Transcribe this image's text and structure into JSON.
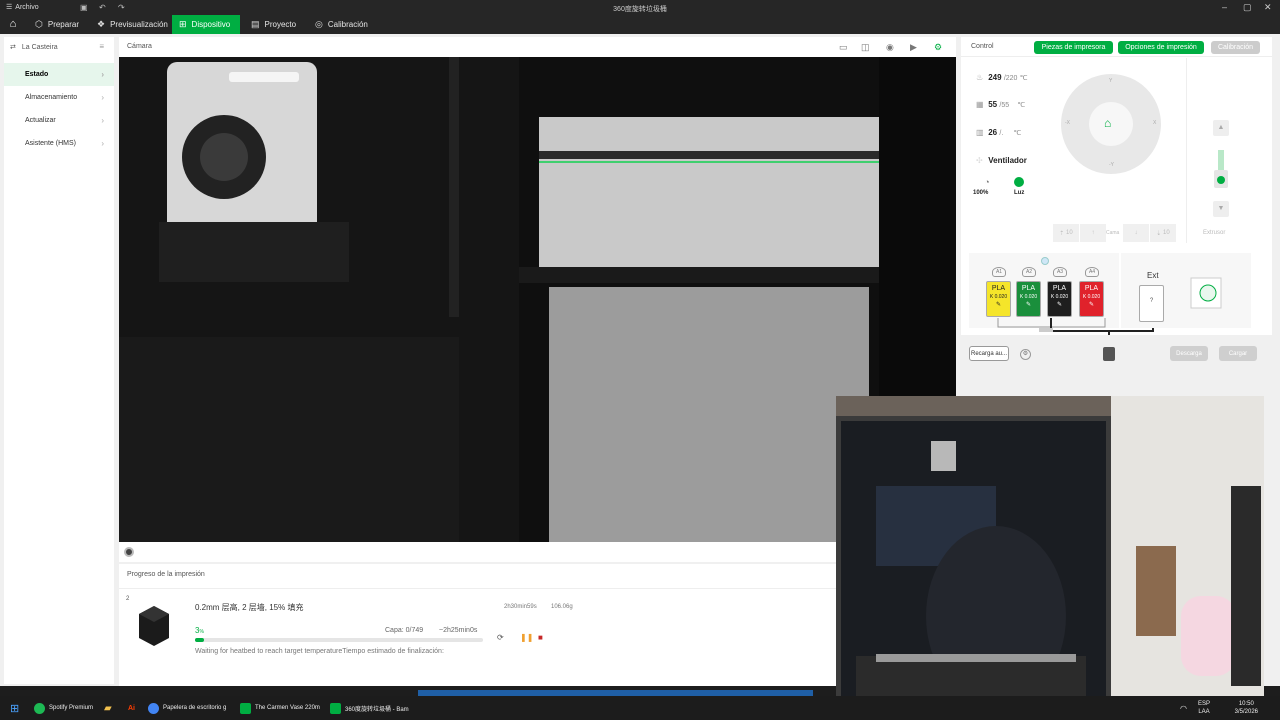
{
  "window": {
    "title": "360度旋转垃圾桶",
    "menu_label": "Archivo"
  },
  "nav": {
    "tabs": [
      {
        "label": "Preparar"
      },
      {
        "label": "Previsualización"
      },
      {
        "label": "Dispositivo"
      },
      {
        "label": "Proyecto"
      },
      {
        "label": "Calibración"
      }
    ]
  },
  "sidebar": {
    "printer_name": "La Casteira",
    "items": [
      {
        "label": "Estado"
      },
      {
        "label": "Almacenamiento"
      },
      {
        "label": "Actualizar"
      },
      {
        "label": "Asistente (HMS)"
      }
    ]
  },
  "camera": {
    "label": "Cámara"
  },
  "progress": {
    "title": "Progreso de la impresión",
    "count": "2",
    "job_name": "0.2mm 层高, 2 层墙, 15% 填充",
    "time": "2h30min59s",
    "weight": "106.06g",
    "percent": "3",
    "percent_unit": "%",
    "layer": "Capa: 0/749",
    "remaining": "~2h25min0s",
    "status": "Waiting for heatbed to reach target temperature",
    "eta_label": "Tiempo estimado de finalización:",
    "fraction": 0.03
  },
  "control": {
    "label": "Control",
    "btn_parts": "Piezas de impresora",
    "btn_options": "Opciones de impresión",
    "btn_calibration": "Calibración",
    "nozzle_temp": "249",
    "nozzle_target": "/220",
    "bed_temp": "55",
    "bed_target": "/55",
    "chamber_temp": "26",
    "chamber_target": "/.",
    "unit": "℃",
    "fan_label": "Ventilador",
    "fan_value": "100%",
    "light_label": "Luz",
    "extruder_label": "Extrusor",
    "step_up_10": "10",
    "step_cama": "Cama",
    "step_down_10": "10"
  },
  "ams": {
    "slots": [
      {
        "id": "A1",
        "type": "PLA",
        "k": "K 0.020",
        "color": "#f5e52a",
        "text": "#222"
      },
      {
        "id": "A2",
        "type": "PLA",
        "k": "K 0.020",
        "color": "#1a8f3c",
        "text": "#fff"
      },
      {
        "id": "A3",
        "type": "PLA",
        "k": "K 0.020",
        "color": "#1e1e1e",
        "text": "#fff"
      },
      {
        "id": "A4",
        "type": "PLA",
        "k": "K 0.020",
        "color": "#e0222b",
        "text": "#fff"
      }
    ],
    "ext_label": "Ext",
    "ext_value": "?",
    "reload_label": "Recarga au...",
    "unload_label": "Descarga",
    "load_label": "Cargar"
  },
  "taskbar": {
    "apps": [
      {
        "label": "Spotify Premium",
        "color": "#1db954"
      },
      {
        "label": "Papelera de escritorio g",
        "color": "#4285f4"
      },
      {
        "label": "The Carmen Vase 220m",
        "color": "#00ae42"
      },
      {
        "label": "360度旋转垃圾桶 - Bam",
        "color": "#00ae42"
      }
    ],
    "lang": "ESP",
    "lang2": "LAA",
    "time": "10:50",
    "date": "3/5/2026"
  },
  "colors": {
    "accent": "#00ae42"
  }
}
